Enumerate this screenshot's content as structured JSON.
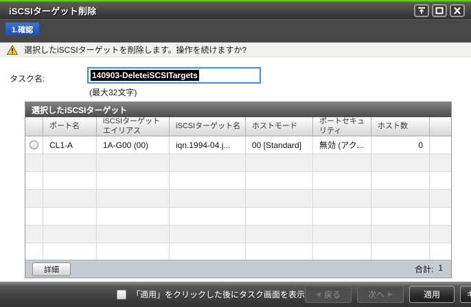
{
  "titlebar": {
    "title": "iSCSIターゲット削除"
  },
  "steps": {
    "step1": "1.確認"
  },
  "warning": {
    "message": "選択したiSCSIターゲットを削除します。操作を続けますか?"
  },
  "task": {
    "label": "タスク名:",
    "value": "140903-DeleteiSCSITargets",
    "max_hint": "(最大32文字)"
  },
  "table": {
    "title": "選択したiSCSIターゲット",
    "headers": {
      "port": "ポート名",
      "alias": "iSCSIターゲットエイリアス",
      "name": "iSCSIターゲット名",
      "host_mode": "ホストモード",
      "port_security": "ポートセキュリティ",
      "host_count": "ホスト数"
    },
    "rows": [
      {
        "port": "CL1-A",
        "alias": "1A-G00 (00)",
        "name": "iqn.1994-04.j...",
        "host_mode": "00 [Standard]",
        "port_security": "無効 (アク...",
        "host_count": "0"
      }
    ],
    "detail_button_label": "詳細",
    "total_label": "合計:",
    "total_value": "1"
  },
  "actions": {
    "show_task_checkbox_label": "「適用」をクリックした後にタスク画面を表示",
    "back_label": "戻る",
    "next_label": "次へ",
    "apply_label": "適用",
    "cancel_label": "キャンセル",
    "help_label": "?"
  },
  "icons": {
    "back_arrow": "◀",
    "next_arrow": "▶"
  },
  "colors": {
    "accent_green": "#4fa90c",
    "tab_blue": "#2a5fc4",
    "selection_bg": "#000000",
    "input_focus_border": "#3e8ede",
    "table_footer_bg": "#c6cbd3"
  }
}
